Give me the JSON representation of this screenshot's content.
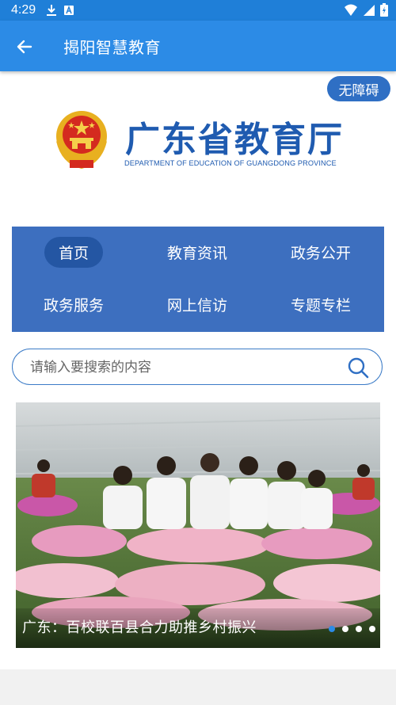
{
  "status_bar": {
    "time": "4:29"
  },
  "app_bar": {
    "title": "揭阳智慧教育"
  },
  "accessibility_button": "无障碍",
  "logo": {
    "cn": "广东省教育厅",
    "en": "DEPARTMENT OF EDUCATION OF GUANGDONG PROVINCE"
  },
  "nav": {
    "items": [
      {
        "label": "首页",
        "active": true
      },
      {
        "label": "教育资讯"
      },
      {
        "label": "政务公开"
      },
      {
        "label": "政务服务"
      },
      {
        "label": "网上信访"
      },
      {
        "label": "专题专栏"
      }
    ]
  },
  "search": {
    "placeholder": "请输入要搜索的内容"
  },
  "banner": {
    "caption": "广东：百校联百县合力助推乡村振兴",
    "slide_count": 4,
    "active_slide": 1
  },
  "colors": {
    "app_bar": "#2c8be6",
    "status_bar": "#1f7fd8",
    "nav_panel": "#3d6fbf",
    "logo_blue": "#1f5bb0"
  }
}
